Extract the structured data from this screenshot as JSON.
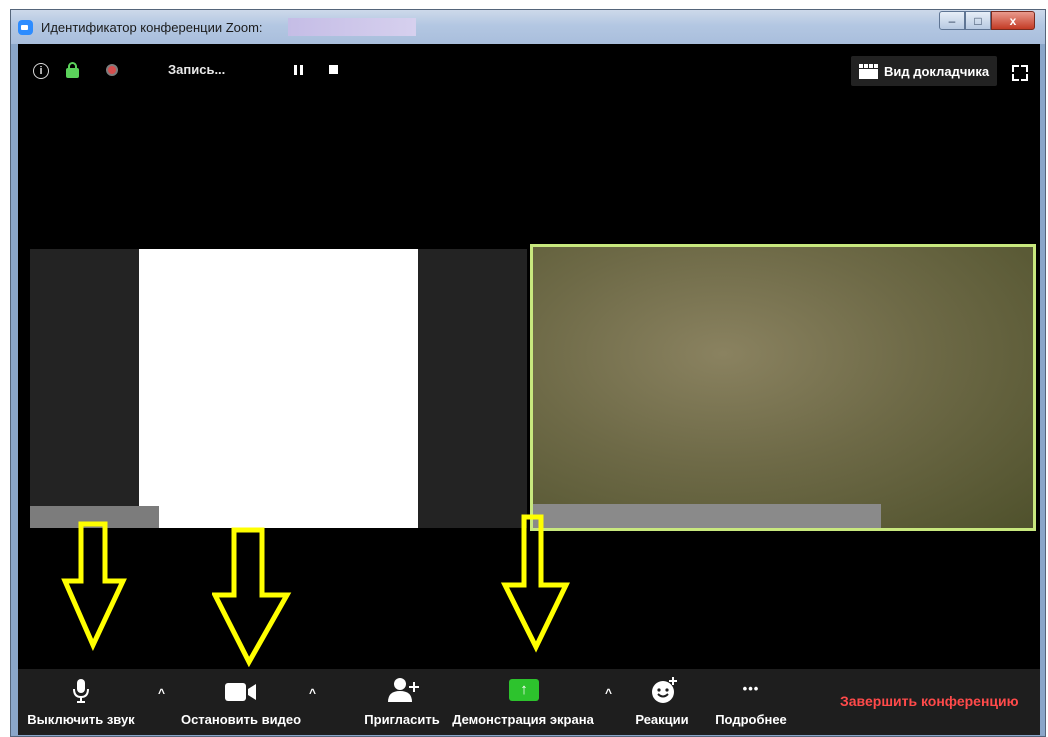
{
  "window": {
    "title": "Идентификатор конференции Zoom:",
    "controls": {
      "minimize": "–",
      "maximize": "□",
      "close": "x"
    }
  },
  "topbar": {
    "recording_label": "Запись...",
    "speaker_view_label": "Вид докладчика",
    "info_glyph": "i"
  },
  "toolbar": {
    "mute_label": "Выключить звук",
    "stop_video_label": "Остановить видео",
    "invite_label": "Пригласить",
    "share_label": "Демонстрация экрана",
    "reactions_label": "Реакции",
    "more_label": "Подробнее",
    "end_label": "Завершить конференцию",
    "caret": "^",
    "more_glyph": "•••",
    "share_glyph": "↑"
  },
  "colors": {
    "end_red": "#ff4a4a",
    "share_green": "#2dc32d",
    "active_speaker_border": "#c8e87e",
    "annotation_arrow": "#ffff00"
  },
  "icons": [
    "info-icon",
    "lock-icon",
    "record-icon",
    "pause-icon",
    "stop-icon",
    "speaker-view-icon",
    "fullscreen-icon",
    "microphone-icon",
    "video-camera-icon",
    "invite-participant-icon",
    "share-screen-icon",
    "reactions-icon",
    "more-icon"
  ]
}
